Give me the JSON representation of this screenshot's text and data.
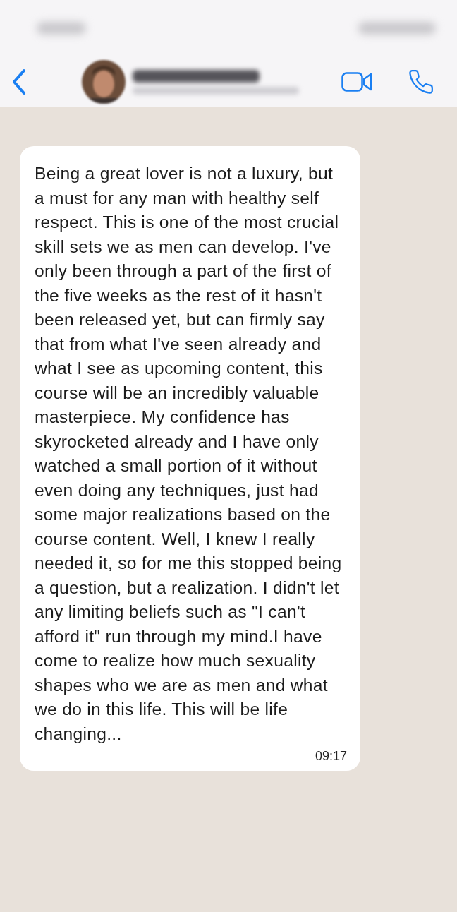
{
  "messages": [
    {
      "text": "Being a great lover is not a luxury, but a must for any man with healthy self respect. This is one of the most crucial skill sets we as men can develop. I've only been through a part of the first of the five weeks as the rest of it hasn't been released yet, but can firmly say that from what I've seen already and what I see as upcoming content, this course will be an incredibly valuable masterpiece. My confidence has skyrocketed already and I have only watched a small portion of it without even doing any techniques, just had some major realizations based on the course content. Well, I knew I really needed it, so for me this stopped being a question, but a realization. I didn't let any limiting beliefs such as \"I can't afford it\" run through my mind.I have come to realize how much sexuality shapes who we are as men and what we do in this life. This will be life changing...",
      "time": "09:17"
    }
  ]
}
